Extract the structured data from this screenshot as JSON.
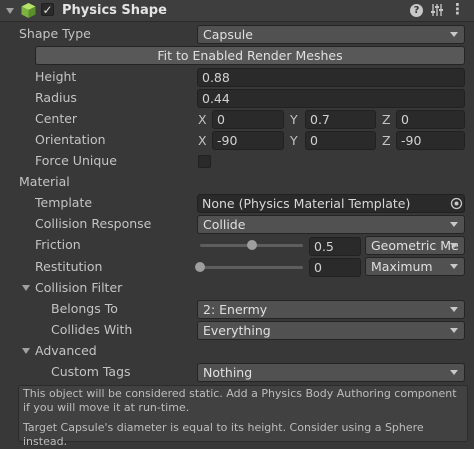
{
  "header": {
    "title": "Physics Shape",
    "enabled": true,
    "icons": [
      "expand-triangle-icon",
      "component-cube-icon",
      "help-icon",
      "preset-sliders-icon",
      "more-vertical-icon"
    ]
  },
  "colors": {
    "cube_icon": "#8bc34a",
    "background": "#383838",
    "field": "#2a2a2a",
    "dropdown": "#515151"
  },
  "shape_type": {
    "label": "Shape Type",
    "value": "Capsule"
  },
  "fit_button": "Fit to Enabled Render Meshes",
  "height": {
    "label": "Height",
    "value": "0.88"
  },
  "radius": {
    "label": "Radius",
    "value": "0.44"
  },
  "center": {
    "label": "Center",
    "x_label": "X",
    "x": "0",
    "y_label": "Y",
    "y": "0.7",
    "z_label": "Z",
    "z": "0"
  },
  "orientation": {
    "label": "Orientation",
    "x_label": "X",
    "x": "-90",
    "y_label": "Y",
    "y": "0",
    "z_label": "Z",
    "z": "-90"
  },
  "force_unique": {
    "label": "Force Unique",
    "checked": false
  },
  "material": {
    "label": "Material",
    "template": {
      "label": "Template",
      "value": "None (Physics Material Template)"
    },
    "collision_response": {
      "label": "Collision Response",
      "value": "Collide"
    },
    "friction": {
      "label": "Friction",
      "value": "0.5",
      "slider_fraction": 0.5,
      "combine": "Geometric Me"
    },
    "restitution": {
      "label": "Restitution",
      "value": "0",
      "slider_fraction": 0.0,
      "combine": "Maximum"
    }
  },
  "collision_filter": {
    "label": "Collision Filter",
    "belongs_to": {
      "label": "Belongs To",
      "value": "2: Enermy"
    },
    "collides_with": {
      "label": "Collides With",
      "value": "Everything"
    }
  },
  "advanced": {
    "label": "Advanced",
    "custom_tags": {
      "label": "Custom Tags",
      "value": "Nothing"
    }
  },
  "help": {
    "static_message": "This object will be considered static. Add a Physics Body Authoring component if you will move it at run-time.",
    "capsule_message": "Target Capsule's diameter is equal to its height. Consider using a Sphere instead."
  }
}
